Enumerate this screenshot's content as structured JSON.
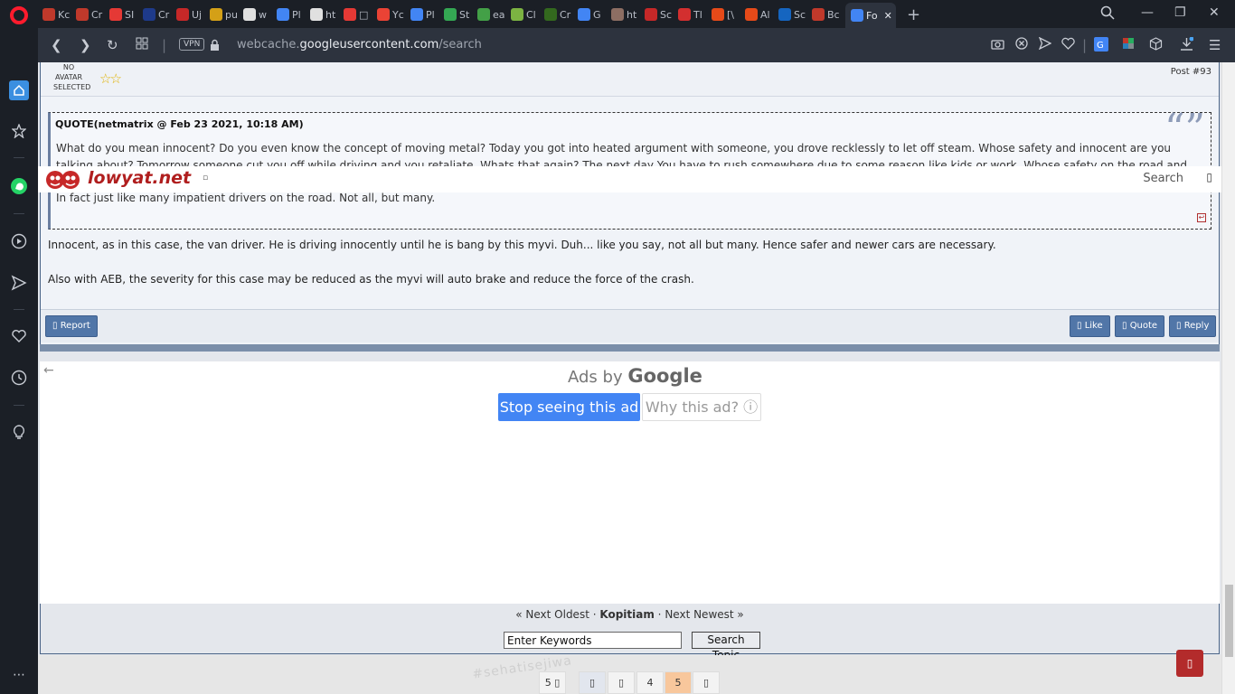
{
  "browser": {
    "tabs": [
      {
        "label": "Kc",
        "color": "#c0392b"
      },
      {
        "label": "Cr",
        "color": "#c0392b"
      },
      {
        "label": "SI",
        "color": "#e53935"
      },
      {
        "label": "Cr",
        "color": "#1e3a8a"
      },
      {
        "label": "Uj",
        "color": "#c62828"
      },
      {
        "label": "pu",
        "color": "#d4a017"
      },
      {
        "label": "w",
        "color": "#e0e0e0"
      },
      {
        "label": "Pl",
        "color": "#4285f4"
      },
      {
        "label": "ht",
        "color": "#e0e0e0"
      },
      {
        "label": "□",
        "color": "#e53935"
      },
      {
        "label": "Yc",
        "color": "#ea4335"
      },
      {
        "label": "Pl",
        "color": "#4285f4"
      },
      {
        "label": "St",
        "color": "#34a853"
      },
      {
        "label": "ea",
        "color": "#43a047"
      },
      {
        "label": "Cl",
        "color": "#7cb342"
      },
      {
        "label": "Cr",
        "color": "#33691e"
      },
      {
        "label": "G",
        "color": "#4285f4"
      },
      {
        "label": "ht",
        "color": "#8d6e63"
      },
      {
        "label": "Sc",
        "color": "#c62828"
      },
      {
        "label": "Tl",
        "color": "#d32f2f"
      },
      {
        "label": "[\\",
        "color": "#e64a19"
      },
      {
        "label": "Al",
        "color": "#e64a19"
      },
      {
        "label": "Sc",
        "color": "#1565c0"
      },
      {
        "label": "Bc",
        "color": "#c0392b"
      },
      {
        "label": "Fo",
        "color": "#4285f4"
      }
    ],
    "new_tab_label": "+",
    "vpn_label": "VPN",
    "url_prefix": "webcache.",
    "url_domain": "googleusercontent.com",
    "url_path": "/search"
  },
  "post": {
    "avatar_label": "NO AVATAR SELECTED",
    "stars": "☆☆",
    "post_number": "Post #93",
    "quote_header": "QUOTE(netmatrix @ Feb 23 2021, 10:18 AM)",
    "quote_line1": "What do you mean innocent? Do you even know the concept of moving metal? Today you got into heated argument with someone, you drove recklessly to let off steam. Whose safety and innocent are you",
    "quote_line2": "talking about? Tomorrow someone cut you off while driving and you retaliate. Whats that again? The next day You have to rush somewhere due to some reason like kids or work. Whose safety on the road and",
    "quote_tail": "In fact just like many impatient drivers on the road. Not all, but many.",
    "body_line1": "Innocent, as in this case, the van driver. He is driving innocently until he is bang by this myvi. Duh... like you say, not all but many. Hence safer and newer cars are necessary.",
    "body_line2": "Also with AEB, the severity for this case may be reduced as the myvi will auto brake and reduce the force of the crash.",
    "report_label": "Report",
    "like_label": "Like",
    "quote_label": "Quote",
    "reply_label": "Reply"
  },
  "lowyat": {
    "logo_text": "lowyat.net",
    "menu_glyph": "▫",
    "search_label": "Search"
  },
  "ad": {
    "ads_by": "Ads by",
    "google": "Google",
    "stop_label": "Stop seeing this ad",
    "why_label": "Why this ad? ⓘ"
  },
  "board": {
    "next_oldest": "« Next Oldest",
    "sep1": " · ",
    "board_name": "Kopitiam",
    "sep2": " · ",
    "next_newest": "Next Newest »",
    "keyword_placeholder": "Enter Keywords",
    "search_topic_label": "Search Topic"
  },
  "pagination": [
    "5 ▯",
    "▯",
    "▯",
    "4",
    "5",
    "▯"
  ],
  "pattern_text": "#sehatisejiwa"
}
